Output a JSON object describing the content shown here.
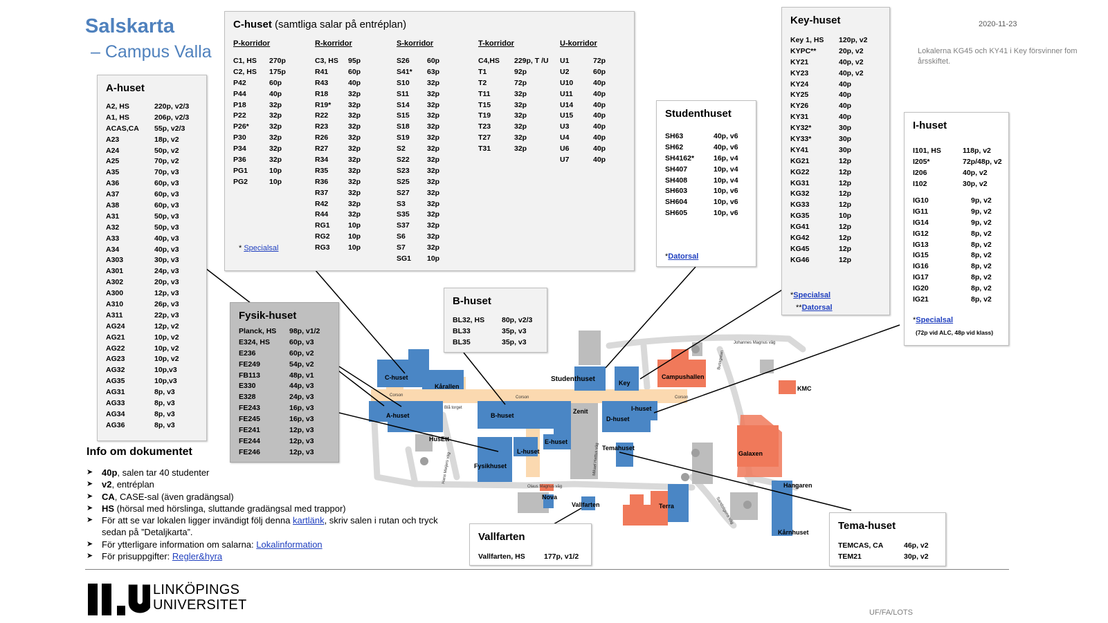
{
  "header": {
    "title": "Salskarta",
    "subtitle": "– Campus Valla",
    "date": "2020-11-23",
    "notice": "Lokalerna KG45 och KY41 i Key försvinner fom årsskiftet."
  },
  "a_huset": {
    "title": "A-huset",
    "rooms": [
      [
        "A2, HS",
        "220p, v2/3"
      ],
      [
        "A1, HS",
        "206p, v2/3"
      ],
      [
        "ACAS,CA",
        "55p, v2/3"
      ],
      [
        "A23",
        "18p, v2"
      ],
      [
        "A24",
        "50p, v2"
      ],
      [
        "A25",
        "70p, v2"
      ],
      [
        "A35",
        "70p, v3"
      ],
      [
        "A36",
        "60p, v3"
      ],
      [
        "A37",
        "60p, v3"
      ],
      [
        "A38",
        "60p, v3"
      ],
      [
        "A31",
        "50p, v3"
      ],
      [
        "A32",
        "50p, v3"
      ],
      [
        "A33",
        "40p, v3"
      ],
      [
        "A34",
        "40p, v3"
      ],
      [
        "A303",
        "30p, v3"
      ],
      [
        "A301",
        "24p, v3"
      ],
      [
        "A302",
        "20p, v3"
      ],
      [
        "A300",
        "12p, v3"
      ],
      [
        "A310",
        "26p, v3"
      ],
      [
        "A311",
        "22p, v3"
      ],
      [
        "AG24",
        "12p, v2"
      ],
      [
        "AG21",
        "10p, v2"
      ],
      [
        "AG22",
        "10p, v2"
      ],
      [
        "AG23",
        "10p, v2"
      ],
      [
        "AG32",
        "10p,v3"
      ],
      [
        "AG35",
        "10p,v3"
      ],
      [
        "AG31",
        "8p, v3"
      ],
      [
        "AG33",
        "8p, v3"
      ],
      [
        "AG34",
        "8p, v3"
      ],
      [
        "AG36",
        "8p, v3"
      ]
    ]
  },
  "c_huset": {
    "title": "C-huset",
    "title_note": "(samtliga salar på entréplan)",
    "corridors": [
      {
        "head": "P-korridor",
        "rooms": [
          [
            "C1, HS",
            "270p"
          ],
          [
            "C2, HS",
            "175p"
          ],
          [
            "P42",
            "60p"
          ],
          [
            "P44",
            "40p"
          ],
          [
            "P18",
            "32p"
          ],
          [
            "P22",
            "32p"
          ],
          [
            "P26*",
            "32p"
          ],
          [
            "P30",
            "32p"
          ],
          [
            "P34",
            "32p"
          ],
          [
            "P36",
            "32p"
          ],
          [
            "PG1",
            "10p"
          ],
          [
            "PG2",
            "10p"
          ]
        ]
      },
      {
        "head": "R-korridor",
        "rooms": [
          [
            "C3, HS",
            "95p"
          ],
          [
            "R41",
            "60p"
          ],
          [
            "R43",
            "40p"
          ],
          [
            "R18",
            "32p"
          ],
          [
            "R19*",
            "32p"
          ],
          [
            "R22",
            "32p"
          ],
          [
            "R23",
            "32p"
          ],
          [
            "R26",
            "32p"
          ],
          [
            "R27",
            "32p"
          ],
          [
            "R34",
            "32p"
          ],
          [
            "R35",
            "32p"
          ],
          [
            "R36",
            "32p"
          ],
          [
            "R37",
            "32p"
          ],
          [
            "R42",
            "32p"
          ],
          [
            "R44",
            "32p"
          ],
          [
            "RG1",
            "10p"
          ],
          [
            "RG2",
            "10p"
          ],
          [
            "RG3",
            "10p"
          ]
        ]
      },
      {
        "head": "S-korridor",
        "rooms": [
          [
            "S26",
            "60p"
          ],
          [
            "S41*",
            "63p"
          ],
          [
            "S10",
            "32p"
          ],
          [
            "S11",
            "32p"
          ],
          [
            "S14",
            "32p"
          ],
          [
            "S15",
            "32p"
          ],
          [
            "S18",
            "32p"
          ],
          [
            "S19",
            "32p"
          ],
          [
            "S2",
            "32p"
          ],
          [
            "S22",
            "32p"
          ],
          [
            "S23",
            "32p"
          ],
          [
            "S25",
            "32p"
          ],
          [
            "S27",
            "32p"
          ],
          [
            "S3",
            "32p"
          ],
          [
            "S35",
            "32p"
          ],
          [
            "S37",
            "32p"
          ],
          [
            "S6",
            "32p"
          ],
          [
            "S7",
            "32p"
          ],
          [
            "SG1",
            "10p"
          ]
        ]
      },
      {
        "head": "T-korridor",
        "rooms": [
          [
            "C4,HS",
            "229p, T /U"
          ],
          [
            "T1",
            "92p"
          ],
          [
            "T2",
            "72p"
          ],
          [
            "T11",
            "32p"
          ],
          [
            "T15",
            "32p"
          ],
          [
            "T19",
            "32p"
          ],
          [
            "T23",
            "32p"
          ],
          [
            "T27",
            "32p"
          ],
          [
            "T31",
            "32p"
          ]
        ]
      },
      {
        "head": "U-korridor",
        "rooms": [
          [
            "U1",
            "72p"
          ],
          [
            "U2",
            "60p"
          ],
          [
            "U10",
            "40p"
          ],
          [
            "U11",
            "40p"
          ],
          [
            "U14",
            "40p"
          ],
          [
            "U15",
            "40p"
          ],
          [
            "U3",
            "40p"
          ],
          [
            "U4",
            "40p"
          ],
          [
            "U6",
            "40p"
          ],
          [
            "U7",
            "40p"
          ]
        ]
      }
    ],
    "foot_star": "* ",
    "foot_link": "Specialsal"
  },
  "key_huset": {
    "title": "Key-huset",
    "rooms": [
      [
        "Key 1, HS",
        "120p, v2"
      ],
      [
        "KYPC**",
        "20p, v2"
      ],
      [
        "KY21",
        "40p, v2"
      ],
      [
        "KY23",
        "40p, v2"
      ],
      [
        "KY24",
        "40p"
      ],
      [
        "KY25",
        "40p"
      ],
      [
        "KY26",
        "40p"
      ],
      [
        "KY31",
        "40p"
      ],
      [
        "KY32*",
        "30p"
      ],
      [
        "KY33*",
        "30p"
      ],
      [
        "KY41",
        "30p"
      ],
      [
        "KG21",
        "12p"
      ],
      [
        "KG22",
        "12p"
      ],
      [
        "KG31",
        "12p"
      ],
      [
        "KG32",
        "12p"
      ],
      [
        "KG33",
        "12p"
      ],
      [
        "KG35",
        "10p"
      ],
      [
        "KG41",
        "12p"
      ],
      [
        "KG42",
        "12p"
      ],
      [
        "KG45",
        "12p"
      ],
      [
        "KG46",
        "12p"
      ]
    ],
    "foot1_star": "*",
    "foot1_link": "Specialsal",
    "foot2_star": "**",
    "foot2_link": "Datorsal"
  },
  "studenthuset": {
    "title": "Studenthuset",
    "rooms": [
      [
        "SH63",
        "40p, v6"
      ],
      [
        "SH62",
        "40p, v6"
      ],
      [
        "SH4162*",
        "16p, v4"
      ],
      [
        "SH407",
        "10p, v4"
      ],
      [
        "SH408",
        "10p, v4"
      ],
      [
        "SH603",
        "10p, v6"
      ],
      [
        "SH604",
        "10p, v6"
      ],
      [
        "SH605",
        "10p, v6"
      ]
    ],
    "foot_star": "*",
    "foot_link": "Datorsal"
  },
  "i_huset": {
    "title": "I-huset",
    "rooms": [
      [
        "I101, HS",
        "118p, v2"
      ],
      [
        "I205*",
        "72p/48p, v2"
      ],
      [
        "I206",
        "40p, v2"
      ],
      [
        "I102",
        "30p, v2"
      ]
    ],
    "rooms2": [
      [
        "IG10",
        "9p, v2"
      ],
      [
        "IG11",
        "9p, v2"
      ],
      [
        "IG14",
        "9p, v2"
      ],
      [
        "IG12",
        "8p, v2"
      ],
      [
        "IG13",
        "8p, v2"
      ],
      [
        "IG15",
        "8p, v2"
      ],
      [
        "IG16",
        "8p, v2"
      ],
      [
        "IG17",
        "8p, v2"
      ],
      [
        "IG20",
        "8p, v2"
      ],
      [
        "IG21",
        "8p, v2"
      ]
    ],
    "foot_star": "*",
    "foot_link": "Specialsal",
    "foot_note": "(72p vid ALC, 48p vid klass)"
  },
  "b_huset": {
    "title": "B-huset",
    "rooms": [
      [
        "BL32, HS",
        "80p, v2/3"
      ],
      [
        "BL33",
        "35p, v3"
      ],
      [
        "BL35",
        "35p, v3"
      ]
    ]
  },
  "fysik_huset": {
    "title": "Fysik-huset",
    "rooms": [
      [
        "Planck, HS",
        "98p, v1/2"
      ],
      [
        "E324, HS",
        "60p, v3"
      ],
      [
        "E236",
        "60p, v2"
      ],
      [
        "FE249",
        "54p, v2"
      ],
      [
        "FB113",
        "48p, v1"
      ],
      [
        "E330",
        "44p, v3"
      ],
      [
        "E328",
        "24p, v3"
      ],
      [
        "FE243",
        "16p, v3"
      ],
      [
        "FE245",
        "16p, v3"
      ],
      [
        "FE241",
        "12p, v3"
      ],
      [
        "FE244",
        "12p, v3"
      ],
      [
        "FE246",
        "12p, v3"
      ]
    ]
  },
  "vallfarten": {
    "title": "Vallfarten",
    "rooms": [
      [
        "Vallfarten, HS",
        "177p, v1/2"
      ]
    ]
  },
  "tema_huset": {
    "title": "Tema-huset",
    "rooms": [
      [
        "TEMCAS, CA",
        "46p, v2"
      ],
      [
        "TEM21",
        "30p, v2"
      ]
    ]
  },
  "info": {
    "title": "Info om dokumentet",
    "items": [
      {
        "bold": "40p",
        "text": ", salen tar 40 studenter"
      },
      {
        "bold": "v2",
        "text": ", entréplan"
      },
      {
        "bold": "CA",
        "text": ", CASE-sal (även gradängsal)"
      },
      {
        "bold": "HS",
        "text": " (hörsal med hörslinga, sluttande gradängsal med trappor)"
      }
    ],
    "item5_pre": "För att se var lokalen ligger invändigt följ denna ",
    "item5_link": "kartlänk",
    "item5_post": ", skriv salen i rutan och tryck sedan på ”Detaljkarta”.",
    "item6_pre": "För ytterligare information om salarna: ",
    "item6_link": "Lokalinformation",
    "item7_pre": "För prisuppgifter: ",
    "item7_link": "Regler&hyra"
  },
  "map": {
    "labels": {
      "c_huset": "C-huset",
      "korallen": "Kårallen",
      "corson1": "Corson",
      "corson2": "Corson",
      "corson3": "Corson",
      "bla_torget": "Blå torget",
      "a_huset": "A-huset",
      "b_huset": "B-huset",
      "zenit": "Zenit",
      "studenthuset": "Studenthuset",
      "key": "Key",
      "campushallen": "Campushallen",
      "kmc": "KMC",
      "i_huset": "I-huset",
      "d_huset": "D-huset",
      "husett": "HusEtt",
      "l_huset": "L-huset",
      "e_huset": "E-huset",
      "tema_huset": "Temahuset",
      "galaxen": "Galaxen",
      "fysikhuset": "Fysikhuset",
      "nova": "Nova",
      "vallfarten": "Vallfarten",
      "terra": "Terra",
      "hangaren": "Hangaren",
      "karnhuset": "Kårnhuset",
      "olaus": "Olaus Magnus väg",
      "johannes": "Johannes Magnus väg",
      "hans_meijer": "Hans Meijers väg",
      "mikael": "Mikael Hattus väg",
      "brosgatan": "Bussgatan",
      "sandstrom": "Sandstigens väg",
      "parking": "P"
    }
  },
  "logo": {
    "line1": "LINKÖPINGS",
    "line2": "UNIVERSITET"
  },
  "footer": {
    "code": "UF/FA/LOTS"
  },
  "colors": {
    "title_blue": "#4f81bd",
    "building_blue": "#4a86c5",
    "building_orange": "#f0795a",
    "building_grey": "#bdbdbd",
    "corridor_sand": "#fbd9b0",
    "link_blue": "#1f3fbf"
  }
}
